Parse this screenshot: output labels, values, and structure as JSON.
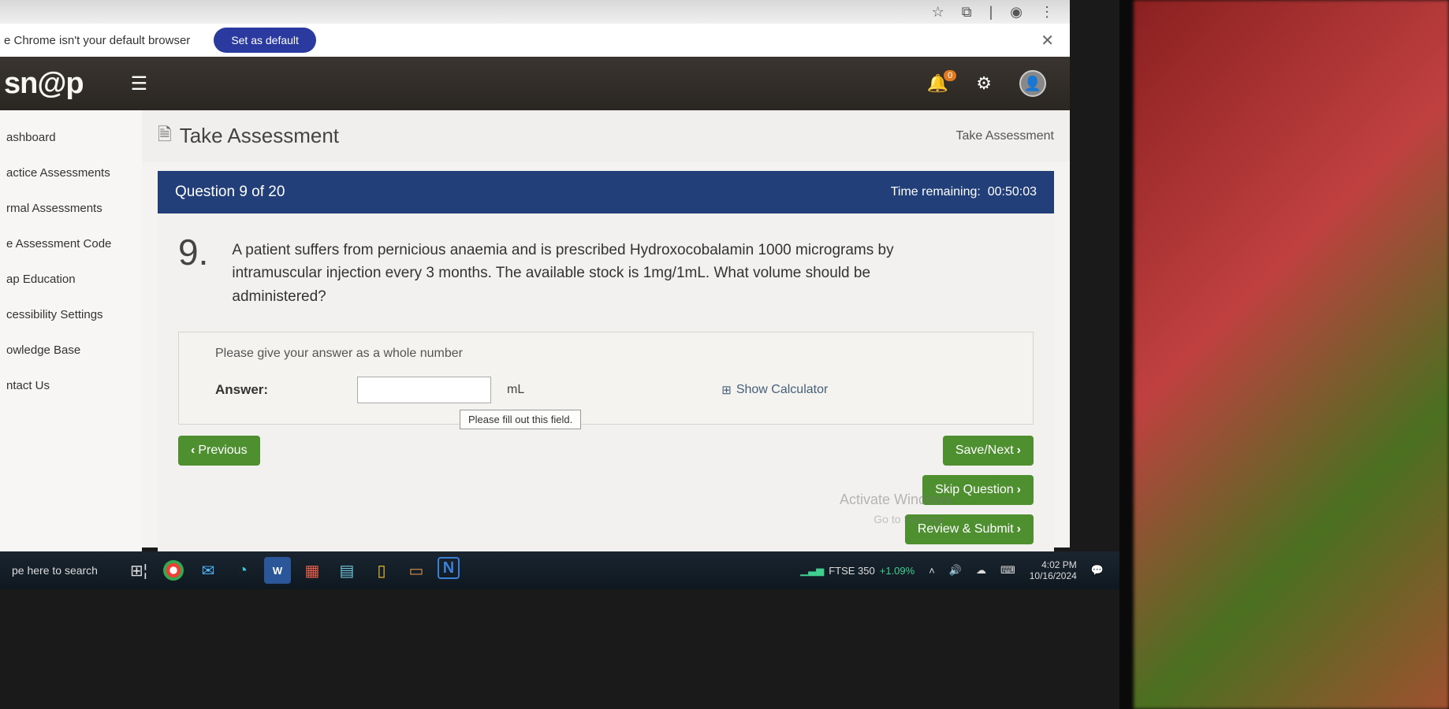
{
  "chrome": {
    "default_msg": "e Chrome isn't your default browser",
    "default_btn": "Set as default"
  },
  "header": {
    "brand": "sn@p",
    "notif_count": "0"
  },
  "sidebar": {
    "items": [
      "ashboard",
      "actice Assessments",
      "rmal Assessments",
      "e Assessment Code",
      "ap Education",
      "cessibility Settings",
      "owledge Base",
      "ntact Us"
    ]
  },
  "page": {
    "title": "Take Assessment",
    "breadcrumb": "Take Assessment"
  },
  "question_bar": {
    "label": "Question 9 of 20",
    "timer_label": "Time remaining:",
    "timer_value": "00:50:03"
  },
  "question": {
    "number": "9.",
    "text": "A patient suffers from pernicious anaemia and is prescribed Hydroxocobalamin 1000 micrograms by intramuscular injection every 3 months. The available stock is 1mg/1mL. What volume should be administered?",
    "hint": "Please give your answer as a whole number",
    "answer_label": "Answer:",
    "answer_value": "",
    "unit": "mL",
    "calc_label": "Show Calculator",
    "tooltip": "Please fill out this field."
  },
  "buttons": {
    "previous": "Previous",
    "save_next": "Save/Next",
    "skip": "Skip Question",
    "review": "Review & Submit"
  },
  "watermark": {
    "line1": "Activate Windows",
    "line2": "Go to Settings"
  },
  "taskbar": {
    "search": "pe here to search",
    "ftse_label": "FTSE 350",
    "ftse_change": "+1.09%",
    "time": "4:02 PM",
    "date": "10/16/2024"
  }
}
